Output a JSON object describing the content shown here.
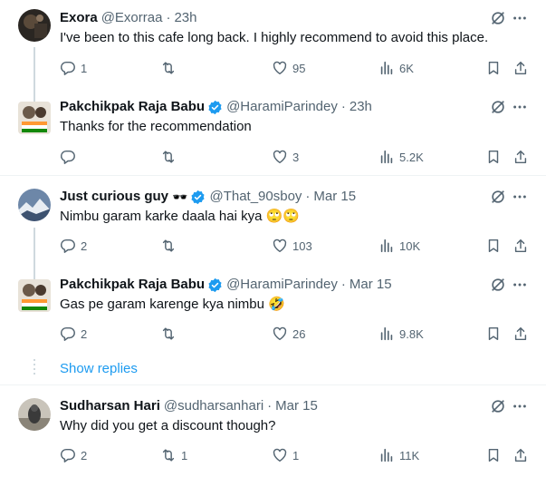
{
  "tweets": [
    {
      "name": "Exora",
      "handle": "@Exorraa",
      "time": "23h",
      "text": "I've been to this cafe long back. I highly recommend to avoid this place.",
      "replies": "1",
      "retweets": "",
      "likes": "95",
      "views": "6K",
      "verified": false
    },
    {
      "name": "Pakchikpak Raja Babu",
      "handle": "@HaramiParindey",
      "time": "23h",
      "text": "Thanks for the recommendation",
      "replies": "",
      "retweets": "",
      "likes": "3",
      "views": "5.2K",
      "verified": true
    },
    {
      "name": "Just curious guy",
      "name_emoji": "🕶️",
      "handle": "@That_90sboy",
      "time": "Mar 15",
      "text": "Nimbu garam karke daala hai kya 🙄🙄",
      "replies": "2",
      "retweets": "",
      "likes": "103",
      "views": "10K",
      "verified": true
    },
    {
      "name": "Pakchikpak Raja Babu",
      "handle": "@HaramiParindey",
      "time": "Mar 15",
      "text": "Gas pe garam karenge kya nimbu 🤣",
      "replies": "2",
      "retweets": "",
      "likes": "26",
      "views": "9.8K",
      "verified": true
    },
    {
      "name": "Sudharsan Hari",
      "handle": "@sudharsanhari",
      "time": "Mar 15",
      "text": "Why did you get a discount though?",
      "replies": "2",
      "retweets": "1",
      "likes": "1",
      "views": "11K",
      "verified": false
    }
  ],
  "show_replies_label": "Show replies",
  "colors": {
    "text": "#0f1419",
    "muted": "#536471",
    "link": "#1d9bf0",
    "verified": "#1d9bf0",
    "divider": "#eff3f4",
    "thread": "#cfd9de"
  },
  "icons": [
    "reply-icon",
    "retweet-icon",
    "like-icon",
    "views-icon",
    "bookmark-icon",
    "share-icon",
    "grok-icon",
    "more-icon",
    "verified-badge-icon"
  ]
}
